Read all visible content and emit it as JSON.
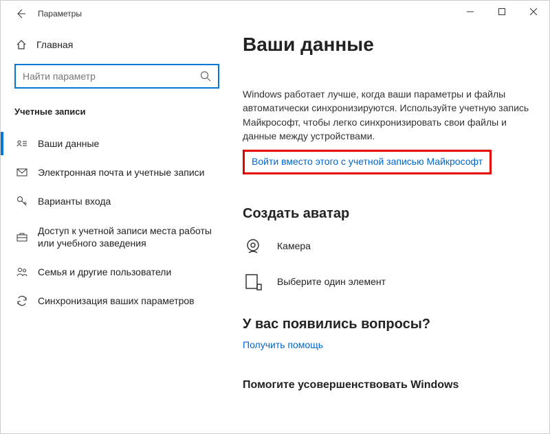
{
  "titlebar": {
    "app_title": "Параметры"
  },
  "sidebar": {
    "home_label": "Главная",
    "search_placeholder": "Найти параметр",
    "section_title": "Учетные записи",
    "items": [
      {
        "label": "Ваши данные"
      },
      {
        "label": "Электронная почта и учетные записи"
      },
      {
        "label": "Варианты входа"
      },
      {
        "label": "Доступ к учетной записи места работы или учебного заведения"
      },
      {
        "label": "Семья и другие пользователи"
      },
      {
        "label": "Синхронизация ваших параметров"
      }
    ]
  },
  "main": {
    "heading": "Ваши данные",
    "description": "Windows работает лучше, когда ваши параметры и файлы автоматически синхронизируются. Используйте учетную запись Майкрософт, чтобы легко синхронизировать свои файлы и данные между устройствами.",
    "signin_link": "Войти вместо этого с учетной записью Майкрософт",
    "avatar_heading": "Создать аватар",
    "camera_label": "Камера",
    "browse_label": "Выберите один элемент",
    "questions_heading": "У вас появились вопросы?",
    "get_help_link": "Получить помощь",
    "footer_heading": "Помогите усовершенствовать Windows"
  }
}
